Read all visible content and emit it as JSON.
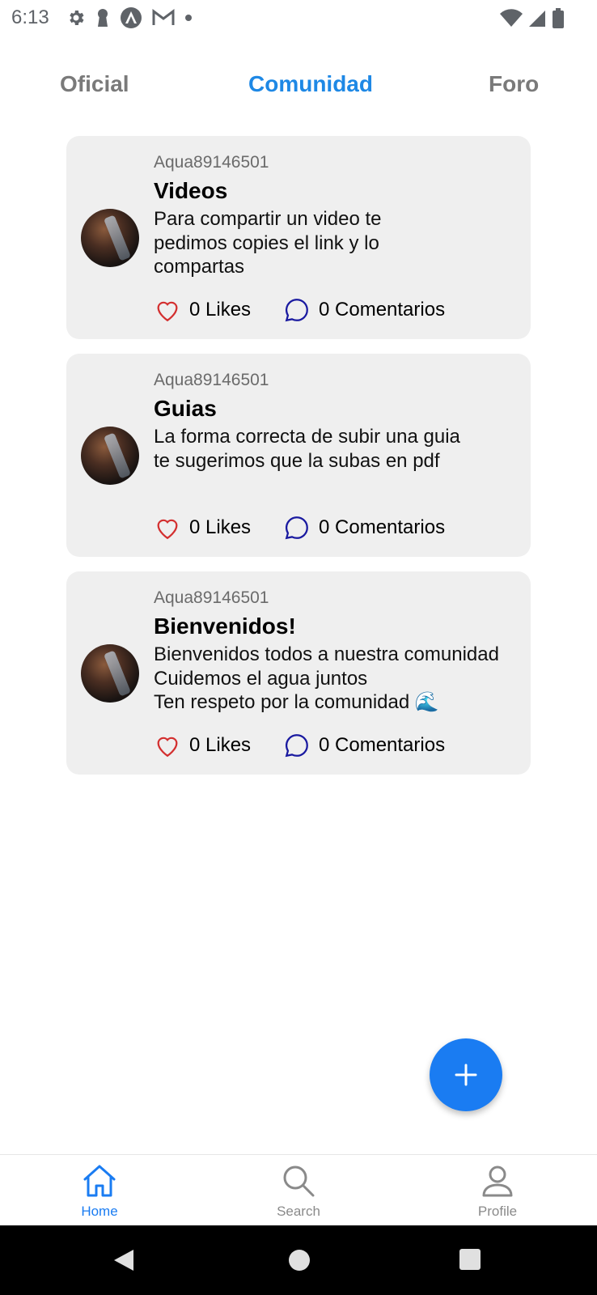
{
  "status_bar": {
    "time": "6:13",
    "left_icons": [
      "settings-icon",
      "keyhole-icon",
      "arch-logo-icon",
      "gmail-icon",
      "dot-icon"
    ],
    "right_icons": [
      "wifi-icon",
      "signal-icon",
      "battery-icon"
    ]
  },
  "tabs": [
    {
      "label": "Oficial",
      "active": false
    },
    {
      "label": "Comunidad",
      "active": true
    },
    {
      "label": "Foro",
      "active": false
    }
  ],
  "posts": [
    {
      "author": "Aqua89146501",
      "title": "Videos",
      "text": "Para compartir un video te\npedimos copies el link y lo\ncompartas",
      "likes": "0 Likes",
      "comments": "0 Comentarios"
    },
    {
      "author": "Aqua89146501",
      "title": "Guias",
      "text": "La forma correcta de subir una guia\nte sugerimos que la subas en pdf",
      "likes": "0 Likes",
      "comments": "0 Comentarios"
    },
    {
      "author": "Aqua89146501",
      "title": "Bienvenidos!",
      "text": "Bienvenidos todos a nuestra comunidad\nCuidemos el agua juntos\nTen respeto por la comunidad 🌊",
      "likes": "0 Likes",
      "comments": "0 Comentarios"
    }
  ],
  "fab": {
    "icon": "plus-icon"
  },
  "bottom_nav": [
    {
      "label": "Home",
      "icon": "home-icon",
      "active": true
    },
    {
      "label": "Search",
      "icon": "search-icon",
      "active": false
    },
    {
      "label": "Profile",
      "icon": "user-icon",
      "active": false
    }
  ],
  "colors": {
    "accent": "#1a7cf2",
    "tab_active": "#1e88e5",
    "like_icon": "#d32f2f",
    "comment_icon": "#1a1aa0",
    "card_bg": "#efefef"
  }
}
